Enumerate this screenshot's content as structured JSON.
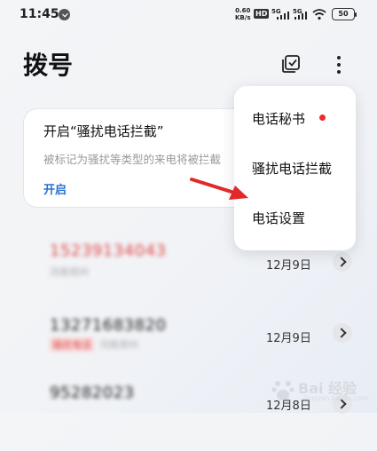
{
  "status_bar": {
    "time": "11:45",
    "net_speed_value": "0.60",
    "net_speed_unit": "KB/s",
    "hd_label": "HD",
    "signal_1": "5G",
    "signal_2": "5G",
    "battery": "50"
  },
  "header": {
    "title": "拨号"
  },
  "intercept_card": {
    "title": "开启“骚扰电话拦截”",
    "description": "被标记为骚扰等类型的来电将被拦截",
    "action": "开启"
  },
  "call_log": [
    {
      "number": "15239134043",
      "sub": "河南郑州",
      "tag": "",
      "date": "12月9日",
      "number_color": "#e04848"
    },
    {
      "number": "13271683820",
      "sub": "河南郑州",
      "tag": "骚扰电话",
      "date": "12月9日",
      "number_color": "#222222"
    },
    {
      "number": "95282023",
      "sub": "",
      "tag": "",
      "date": "12月8日",
      "number_color": "#222222"
    }
  ],
  "popup_menu": {
    "items": [
      "电话秘书",
      "骚扰电话拦截",
      "电话设置"
    ],
    "badge_color": "#ee2a2a"
  },
  "watermark": {
    "text": "Bai 经验",
    "sub": "jingyan.baidu.com"
  }
}
